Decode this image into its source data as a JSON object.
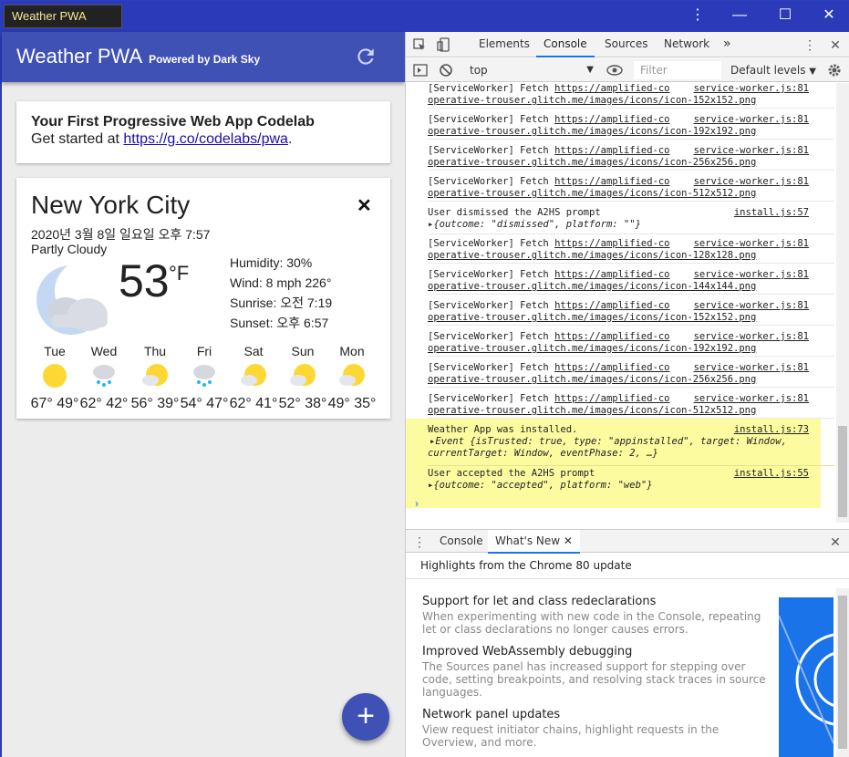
{
  "window": {
    "tab_title": "Weather PWA",
    "menu_icon": "vertical-dots-icon",
    "minimize_icon": "minimize-icon",
    "maximize_icon": "maximize-icon",
    "close_icon": "close-icon"
  },
  "app": {
    "title": "Weather PWA",
    "subtitle": "Powered by Dark Sky",
    "colors": {
      "primary": "#3f51b5",
      "background": "#ececec"
    },
    "intro": {
      "heading": "Your First Progressive Web App Codelab",
      "text_prefix": "Get started at ",
      "link": "https://g.co/codelabs/pwa",
      "text_suffix": "."
    },
    "weather": {
      "city": "New York City",
      "date": "2020년 3월 8일 일요일 오후 7:57",
      "description": "Partly Cloudy",
      "temperature": "53",
      "unit": "°F",
      "humidity": "Humidity: 30%",
      "wind": "Wind: 8 mph 226°",
      "sunrise": "Sunrise: 오전 7:19",
      "sunset": "Sunset: 오후 6:57",
      "forecast": [
        {
          "day": "Tue",
          "icon": "sun-icon",
          "temps": "67° 49°"
        },
        {
          "day": "Wed",
          "icon": "rain-cloud-icon",
          "temps": "62° 42°"
        },
        {
          "day": "Thu",
          "icon": "partly-cloudy-icon",
          "temps": "56° 39°"
        },
        {
          "day": "Fri",
          "icon": "rain-cloud-icon",
          "temps": "54° 47°"
        },
        {
          "day": "Sat",
          "icon": "partly-cloudy-icon",
          "temps": "62° 41°"
        },
        {
          "day": "Sun",
          "icon": "partly-cloudy-icon",
          "temps": "52° 38°"
        },
        {
          "day": "Mon",
          "icon": "partly-cloudy-icon",
          "temps": "49° 35°"
        }
      ]
    },
    "fab_label": "+"
  },
  "devtools": {
    "tabs": [
      "Elements",
      "Console",
      "Sources",
      "Network"
    ],
    "active_tab": "Console",
    "more_tabs": "»",
    "context": "top",
    "filter_placeholder": "Filter",
    "levels": "Default levels",
    "logs": [
      {
        "text": "[ServiceWorker] Fetch ",
        "link": "https://amplified-co",
        "link2": "operative-trouser.glitch.me/images/icons/icon-152x152.png",
        "src": "service-worker.js:81"
      },
      {
        "text": "[ServiceWorker] Fetch ",
        "link": "https://amplified-co",
        "link2": "operative-trouser.glitch.me/images/icons/icon-192x192.png",
        "src": "service-worker.js:81"
      },
      {
        "text": "[ServiceWorker] Fetch ",
        "link": "https://amplified-co",
        "link2": "operative-trouser.glitch.me/images/icons/icon-256x256.png",
        "src": "service-worker.js:81"
      },
      {
        "text": "[ServiceWorker] Fetch ",
        "link": "https://amplified-co",
        "link2": "operative-trouser.glitch.me/images/icons/icon-512x512.png",
        "src": "service-worker.js:81"
      },
      {
        "text": "User dismissed the A2HS prompt",
        "obj": "▸{outcome: \"dismissed\", platform: \"\"}",
        "src": "install.js:57"
      },
      {
        "text": "[ServiceWorker] Fetch ",
        "link": "https://amplified-co",
        "link2": "operative-trouser.glitch.me/images/icons/icon-128x128.png",
        "src": "service-worker.js:81"
      },
      {
        "text": "[ServiceWorker] Fetch ",
        "link": "https://amplified-co",
        "link2": "operative-trouser.glitch.me/images/icons/icon-144x144.png",
        "src": "service-worker.js:81"
      },
      {
        "text": "[ServiceWorker] Fetch ",
        "link": "https://amplified-co",
        "link2": "operative-trouser.glitch.me/images/icons/icon-152x152.png",
        "src": "service-worker.js:81"
      },
      {
        "text": "[ServiceWorker] Fetch ",
        "link": "https://amplified-co",
        "link2": "operative-trouser.glitch.me/images/icons/icon-192x192.png",
        "src": "service-worker.js:81"
      },
      {
        "text": "[ServiceWorker] Fetch ",
        "link": "https://amplified-co",
        "link2": "operative-trouser.glitch.me/images/icons/icon-256x256.png",
        "src": "service-worker.js:81"
      },
      {
        "text": "[ServiceWorker] Fetch ",
        "link": "https://amplified-co",
        "link2": "operative-trouser.glitch.me/images/icons/icon-512x512.png",
        "src": "service-worker.js:81"
      },
      {
        "text": "Weather App was installed.",
        "obj": "Event {isTrusted: true, type: \"appinstalled\", target: Window,",
        "obj2": "currentTarget: Window, eventPhase: 2, …}",
        "src": "install.js:73"
      },
      {
        "text": "User accepted the A2HS prompt",
        "obj": "▸{outcome: \"accepted\", platform: \"web\"}",
        "src": "install.js:55"
      }
    ],
    "drawer_tabs": [
      "Console",
      "What's New"
    ],
    "highlights": "Highlights from the Chrome 80 update",
    "news": [
      {
        "title": "Support for let and class redeclarations",
        "desc": "When experimenting with new code in the Console, repeating let or class declarations no longer causes errors."
      },
      {
        "title": "Improved WebAssembly debugging",
        "desc": "The Sources panel has increased support for stepping over code, setting breakpoints, and resolving stack traces in source languages."
      },
      {
        "title": "Network panel updates",
        "desc": "View request initiator chains, highlight requests in the Overview, and more."
      }
    ]
  }
}
